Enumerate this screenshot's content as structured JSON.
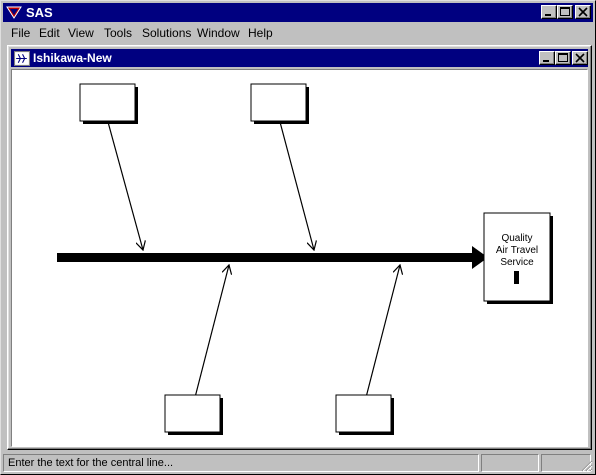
{
  "app": {
    "title": "SAS"
  },
  "menu": {
    "items": [
      {
        "label": "File"
      },
      {
        "label": "Edit"
      },
      {
        "label": "View"
      },
      {
        "label": "Tools"
      },
      {
        "label": "Solutions"
      },
      {
        "label": "Window"
      },
      {
        "label": "Help"
      }
    ]
  },
  "document": {
    "title": "Ishikawa-New",
    "effect_label": [
      "Quality",
      "Air Travel",
      "Service"
    ],
    "cause_boxes": [
      "",
      "",
      "",
      ""
    ]
  },
  "status": {
    "message": "Enter the text for the central line..."
  },
  "colors": {
    "titlebar": "#000080",
    "face": "#c0c0c0",
    "canvas": "#ffffff"
  }
}
